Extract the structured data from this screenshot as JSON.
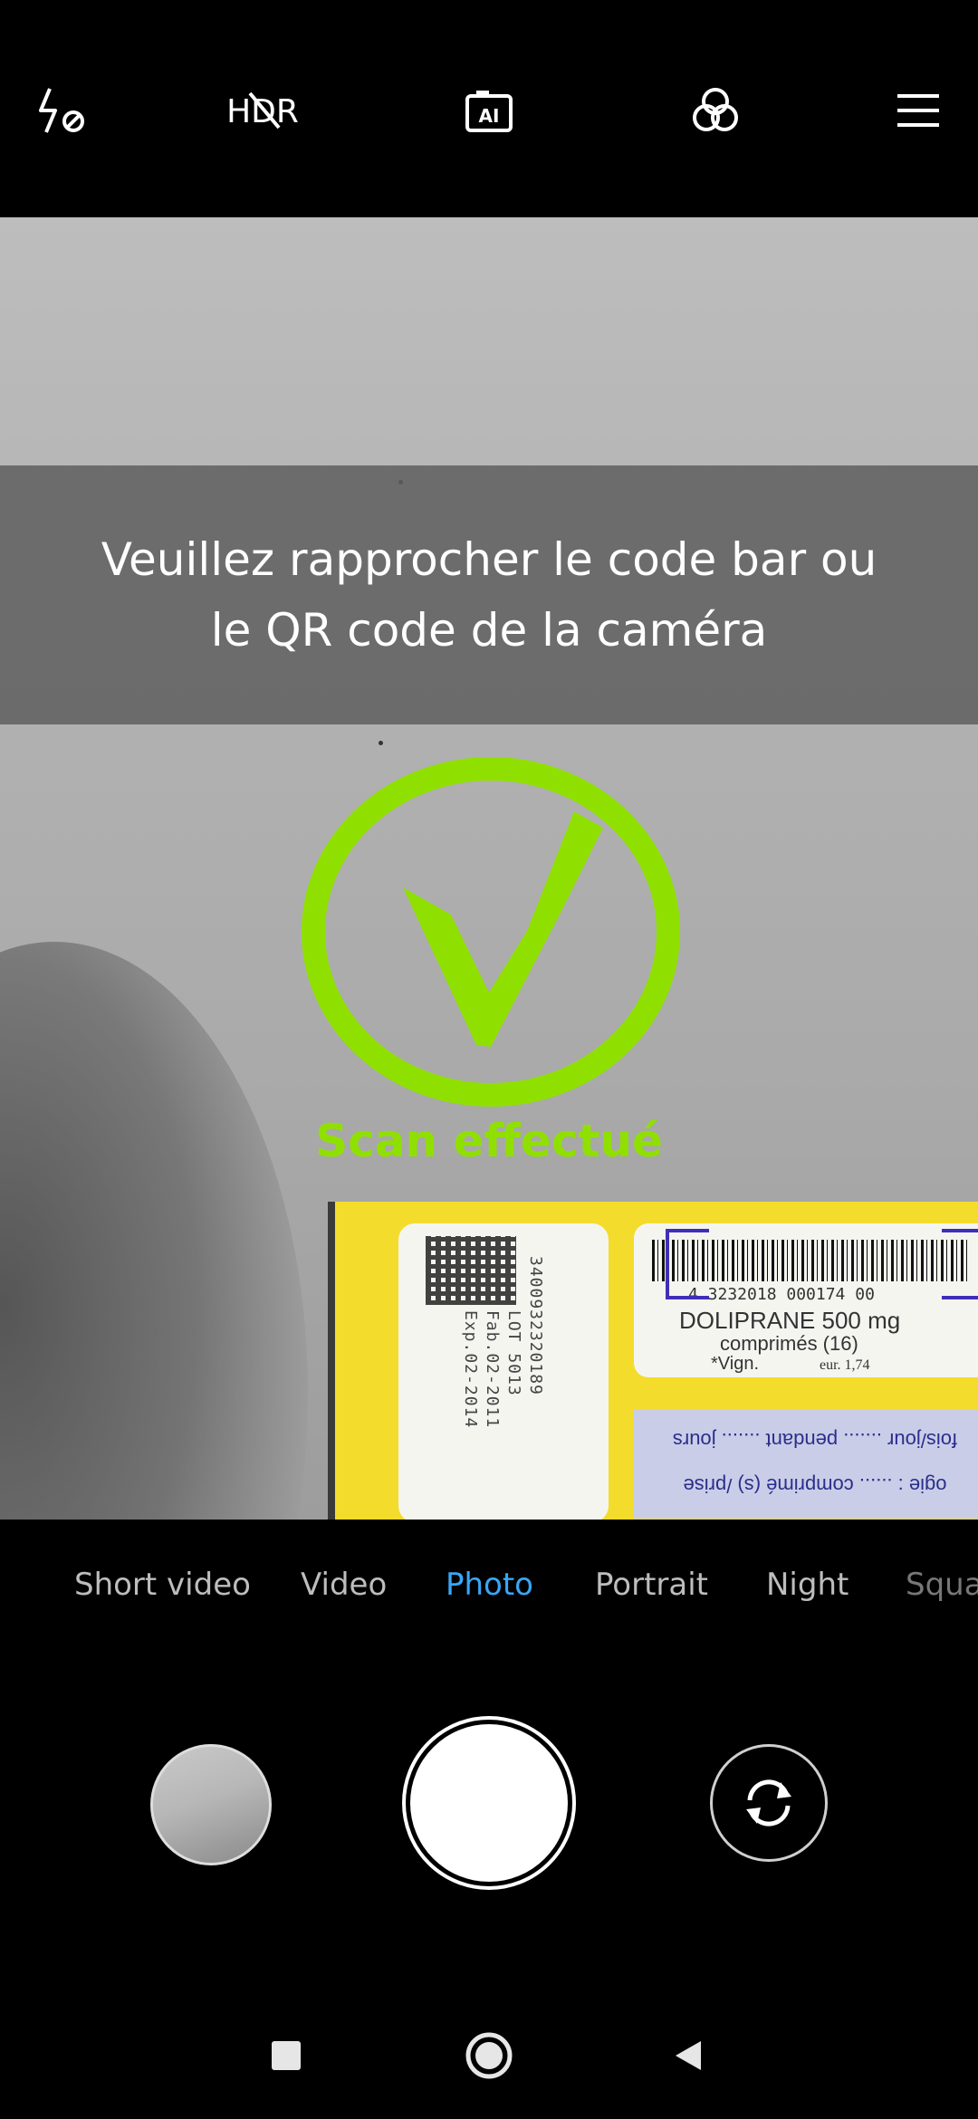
{
  "top_bar": {
    "icons": [
      "flash-off-icon",
      "hdr-icon",
      "ai-icon",
      "filters-icon",
      "menu-icon"
    ]
  },
  "banner": {
    "text": "Veuillez rapprocher le code  bar ou\nle QR code de la caméra"
  },
  "scan": {
    "status_label": "Scan effectué",
    "status_color": "#8fe000"
  },
  "product": {
    "barcode_number": "4 3232018 000174 00",
    "name": "DOLIPRANE 500 mg",
    "form": "comprimés (16)",
    "vign_label": "*Vign.",
    "price": "eur. 1,74",
    "code_line_1": "3400932320189",
    "code_line_2": "LOT 5013",
    "code_line_3": "Fab.02-2011",
    "code_line_4": "Exp.02-2014",
    "band_line_1": "fois/jour ....... pendant ....... jours",
    "band_line_2": "ogie : ...... comprimé (s) /prise"
  },
  "modes": {
    "items": [
      "Short video",
      "Video",
      "Photo",
      "Portrait",
      "Night",
      "Squa"
    ],
    "active": "Photo",
    "active_color": "#3aa6f5"
  },
  "controls": {
    "icons": [
      "gallery-thumbnail",
      "shutter-button",
      "switch-camera-icon"
    ]
  },
  "nav": {
    "icons": [
      "recents-icon",
      "home-icon",
      "back-icon"
    ]
  }
}
